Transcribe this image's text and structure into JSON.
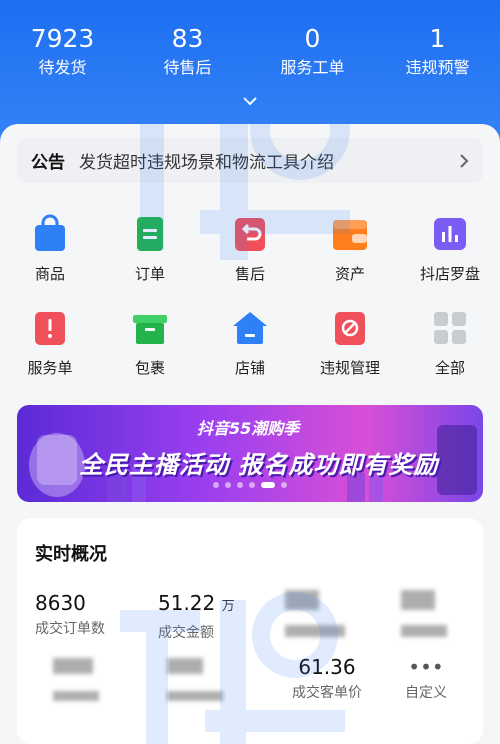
{
  "stats": [
    {
      "value": "7923",
      "label": "待发货"
    },
    {
      "value": "83",
      "label": "待售后"
    },
    {
      "value": "0",
      "label": "服务工单"
    },
    {
      "value": "1",
      "label": "违规预警"
    }
  ],
  "notice": {
    "tag": "公告",
    "text": "发货超时违规场景和物流工具介绍"
  },
  "grid": {
    "row1": [
      {
        "label": "商品",
        "icon": "bag-icon",
        "color": "#2f7ff7"
      },
      {
        "label": "订单",
        "icon": "order-icon",
        "color": "#23b34a"
      },
      {
        "label": "售后",
        "icon": "return-icon",
        "color": "#f0505a"
      },
      {
        "label": "资产",
        "icon": "wallet-icon",
        "color": "#ff7d1a"
      },
      {
        "label": "抖店罗盘",
        "icon": "chart-icon",
        "color": "#7b5cf5"
      }
    ],
    "row2": [
      {
        "label": "服务单",
        "icon": "alert-icon",
        "color": "#f0505a"
      },
      {
        "label": "包裹",
        "icon": "box-icon",
        "color": "#23b34a"
      },
      {
        "label": "店铺",
        "icon": "shop-icon",
        "color": "#2f7ff7"
      },
      {
        "label": "违规管理",
        "icon": "ban-icon",
        "color": "#f0505a"
      },
      {
        "label": "全部",
        "icon": "grid-icon",
        "color": "#c8cbd0"
      }
    ]
  },
  "banner": {
    "sub": "抖音55潮购季",
    "main": "全民主播活动 报名成功即有奖励"
  },
  "overview": {
    "title": "实时概况",
    "items": [
      {
        "value": "8630",
        "unit": "",
        "label": "成交订单数"
      },
      {
        "value": "51.22",
        "unit": "万",
        "label": "成交金额"
      },
      {
        "value": "61.36",
        "unit": "",
        "label": "成交客单价"
      },
      {
        "value": "•••",
        "unit": "",
        "label": "自定义"
      }
    ]
  }
}
